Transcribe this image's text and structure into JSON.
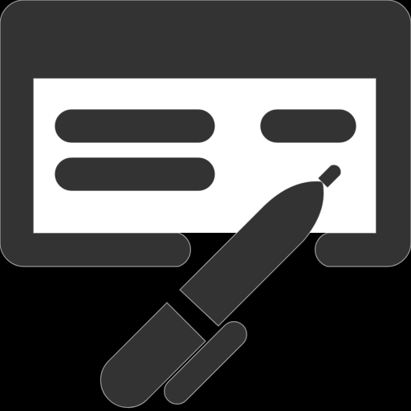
{
  "icon": {
    "name": "check-signing-icon",
    "colors": {
      "background": "#000000",
      "glyph": "#333333",
      "outline": "#ffffff"
    },
    "parts": [
      "check-panel",
      "check-lines",
      "pen"
    ]
  }
}
